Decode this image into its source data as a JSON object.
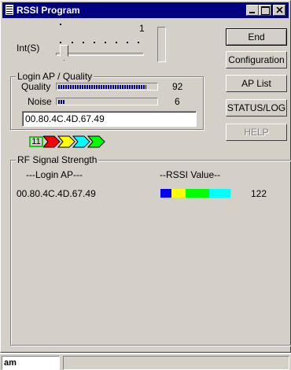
{
  "window": {
    "title": "RSSI Program"
  },
  "slider": {
    "label": "Int(S)",
    "max_label": "1"
  },
  "buttons": {
    "end": "End",
    "configuration": "Configuration",
    "ap_list": "AP List",
    "status_log": "STATUS/LOG",
    "help": "HELP"
  },
  "login_ap": {
    "group_label": "Login AP / Quality",
    "quality_label": "Quality",
    "quality_value": "92",
    "noise_label": "Noise",
    "noise_value": "6",
    "mac": "00.80.4C.4D.67.49"
  },
  "channel": {
    "number": "11",
    "arrow_colors": [
      "#ff0000",
      "#ffff00",
      "#00ffff",
      "#00ff00"
    ]
  },
  "rf": {
    "group_label": "RF Signal Strength",
    "col_login_ap": "---Login AP---",
    "col_rssi": "--RSSI Value--",
    "row_mac": "00.80.4C.4D.67.49",
    "row_value": "122",
    "bar_colors": [
      "#0000ff",
      "#ffff00",
      "#00ff00",
      "#00ffff"
    ]
  },
  "statusbar": {
    "text": "am"
  }
}
